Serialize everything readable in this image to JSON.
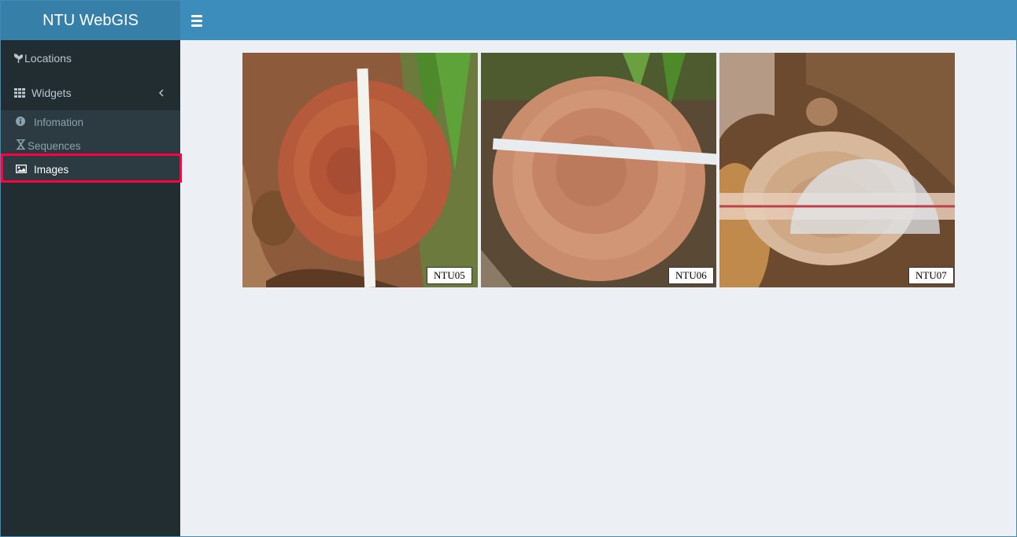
{
  "app": {
    "title": "NTU WebGIS"
  },
  "header": {
    "toggle_icon": "hamburger-icon"
  },
  "sidebar": {
    "items": [
      {
        "label": "Locations",
        "icon": "seedling-icon"
      },
      {
        "label": "Widgets",
        "icon": "grid-icon",
        "expand_icon": "chevron-left-icon"
      }
    ],
    "subitems": [
      {
        "label": "Infomation",
        "icon": "info-circle-icon"
      },
      {
        "label": "Sequences",
        "icon": "hourglass-icon"
      },
      {
        "label": "Images",
        "icon": "image-icon",
        "active": true
      }
    ]
  },
  "gallery": [
    {
      "caption": "NTU05"
    },
    {
      "caption": "NTU06"
    },
    {
      "caption": "NTU07"
    }
  ],
  "colors": {
    "header": "#3c8dbc",
    "logo": "#367fa9",
    "sidebar": "#222d32",
    "submenu": "#2c3b41",
    "content": "#ecf0f5",
    "highlight": "#ff0040"
  }
}
